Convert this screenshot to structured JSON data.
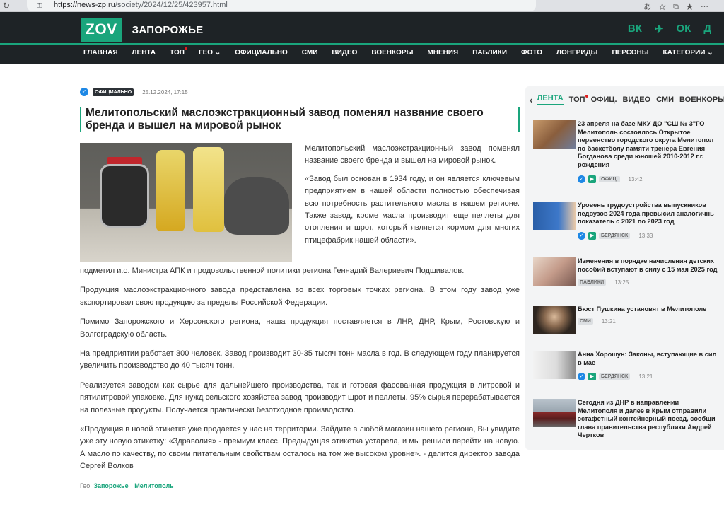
{
  "browser": {
    "url_host": "https://news-zp.ru",
    "url_path": "/society/2024/12/25/423957.html",
    "reload_glyph": "↻",
    "lock_glyph": "⚿",
    "toolbar_glyphs": "あ☆⧉★⋯"
  },
  "header": {
    "logo": "ZOV",
    "city": "ЗАПОРОЖЬЕ",
    "social": [
      "ВК",
      "✈",
      "ОК",
      "Д"
    ],
    "accent": "#1aa57c",
    "band_color": "#1e2326"
  },
  "menu": [
    {
      "label": "ГЛАВНАЯ"
    },
    {
      "label": "ЛЕНТА"
    },
    {
      "label": "ТОП"
    },
    {
      "label": "ГЕО ⌄"
    },
    {
      "label": "ОФИЦИАЛЬНО"
    },
    {
      "label": "СМИ"
    },
    {
      "label": "ВИДЕО"
    },
    {
      "label": "ВОЕНКОРЫ"
    },
    {
      "label": "МНЕНИЯ"
    },
    {
      "label": "ПАБЛИКИ"
    },
    {
      "label": "ФОТО"
    },
    {
      "label": "ЛОНГРИДЫ"
    },
    {
      "label": "ПЕРСОНЫ"
    },
    {
      "label": "КАТЕГОРИИ ⌄"
    }
  ],
  "article": {
    "tag": "ОФИЦИАЛЬНО",
    "date": "25.12.2024, 17:15",
    "title": "Мелитопольский маслоэкстракционный завод поменял название своего бренда и вышел на мировой рынок",
    "lead": "Мелитопольский маслоэкстракционный завод поменял название своего бренда и вышел на мировой рынок.",
    "quote": "«Завод был основан в 1934 году, и он является ключевым предприятием в нашей области полностью обеспечивая всю потребность растительного масла в нашем регионе. Также завод, кроме масла производит еще пеллеты для отопления и шрот, который является кормом для многих птицефабрик нашей области».",
    "paragraphs": [
      "подметил и.о. Министра АПК и продовольственной политики региона Геннадий Валериевич Подшивалов.",
      "Продукция маслоэкстракционного завода представлена во всех торговых точках региона. В этом году завод уже экспортировал свою продукцию за пределы Российской Федерации.",
      "Помимо Запорожского и Херсонского региона, наша продукция поставляется в ЛНР, ДНР, Крым, Ростовскую и Волгоградскую область.",
      "На предприятии работает 300 человек. Завод производит 30-35 тысяч тонн масла в год. В следующем году планируется увеличить производство до 40 тысяч тонн.",
      "Реализуется заводом как сырье для дальнейшего производства, так и готовая фасованная продукция в литровой и пятилитровой упаковке. Для нужд сельского хозяйства завод производит шрот и пеллеты. 95% сырья перерабатывается на полезные продукты. Получается практически безотходное производство.",
      "«Продукция в новой этикетке уже продается у нас на территории. Зайдите в любой магазин нашего региона, Вы увидите уже эту новую этикетку: «Здраволия» - премиум класс. Предыдущая этикетка устарела, и мы решили перейти на новую. А масло по качеству, по своим питательным свойствам осталось на том же высоком уровне». - делится директор завода Сергей Волков"
    ],
    "geo_label": "Гео:",
    "geo_links": [
      "Запорожье",
      "Мелитополь"
    ]
  },
  "sidebar": {
    "tabs": [
      "ЛЕНТА",
      "ТОП",
      "ОФИЦ.",
      "ВИДЕО",
      "СМИ",
      "ВОЕНКОРЫ"
    ],
    "news": [
      {
        "lines": [
          "23 апреля на базе МКУ ДО \"СШ № 3\"ГО",
          "Мелитополь состоялось Открытое",
          "первенство городского округа Мелитопол",
          "по баскетболу памяти тренера Евгения",
          "Богданова среди юношей 2010-2012 г.г.",
          "рождения"
        ],
        "tag": "ОФИЦ.",
        "time": "13:42"
      },
      {
        "lines": [
          "Уровень трудоустройства выпускников",
          "педвузов 2024 года превысил аналогичнь",
          "показатель с 2021 по 2023 год"
        ],
        "tag": "БЕРДЯНСК",
        "time": "13:33"
      },
      {
        "lines": [
          "Изменения в порядке начисления детских",
          "пособий вступают в силу с 15 мая 2025 год"
        ],
        "tag": "ПАБЛИКИ",
        "time": "13:25"
      },
      {
        "lines": [
          "Бюст Пушкина установят в Мелитополе"
        ],
        "tag": "СМИ",
        "time": "13:21"
      },
      {
        "lines": [
          "Анна Хорошун: Законы, вступающие в сил",
          "в мае"
        ],
        "tag": "БЕРДЯНСК",
        "time": "13:21"
      },
      {
        "lines": [
          "Сегодня из ДНР в направлении",
          "Мелитополя и далее в Крым отправили",
          "эстафетный контейнерный поезд, сообщи",
          "глава правительства республики Андрей",
          "Чертков"
        ],
        "tag": "",
        "time": ""
      }
    ]
  }
}
